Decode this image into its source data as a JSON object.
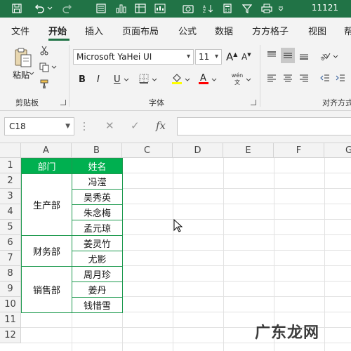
{
  "window": {
    "title": "11121"
  },
  "quick_access": [
    "save-icon",
    "undo-icon",
    "redo-icon",
    "form-icon",
    "chart-icon",
    "table-icon",
    "camera-icon",
    "sort-icon",
    "calculator-icon",
    "filter-icon",
    "print-icon"
  ],
  "ribbon_tabs": [
    {
      "label": "文件",
      "active": false
    },
    {
      "label": "开始",
      "active": true
    },
    {
      "label": "插入",
      "active": false
    },
    {
      "label": "页面布局",
      "active": false
    },
    {
      "label": "公式",
      "active": false
    },
    {
      "label": "数据",
      "active": false
    },
    {
      "label": "方方格子",
      "active": false
    },
    {
      "label": "视图",
      "active": false
    },
    {
      "label": "帮",
      "active": false
    }
  ],
  "clipboard": {
    "paste_label": "粘贴",
    "group_label": "剪贴板"
  },
  "font": {
    "name": "Microsoft YaHei UI",
    "size": "11",
    "grow_label": "A",
    "shrink_label": "A",
    "bold": "B",
    "italic": "I",
    "underline": "U",
    "phonetic_top": "wén",
    "phonetic_bottom": "文",
    "group_label": "字体"
  },
  "alignment": {
    "group_label": "对齐方式"
  },
  "formula_bar": {
    "name_box": "C18",
    "fx_label": "fx",
    "value": ""
  },
  "columns": [
    "A",
    "B",
    "C",
    "D",
    "E",
    "F",
    "G"
  ],
  "rows": [
    "1",
    "2",
    "3",
    "4",
    "5",
    "6",
    "7",
    "8",
    "9",
    "10",
    "11",
    "12"
  ],
  "table": {
    "header_dept": "部门",
    "header_name": "姓名",
    "departments": [
      "生产部",
      "财务部",
      "销售部"
    ],
    "names": [
      "冯滢",
      "吴秀英",
      "朱念梅",
      "孟元琼",
      "姜灵竹",
      "尤影",
      "周月珍",
      "姜丹",
      "钱惜雪"
    ]
  },
  "colors": {
    "title_bar": "#217346",
    "header_fill": "#00b050",
    "cell_border": "#1e9a4f"
  },
  "watermark": "广东龙网"
}
